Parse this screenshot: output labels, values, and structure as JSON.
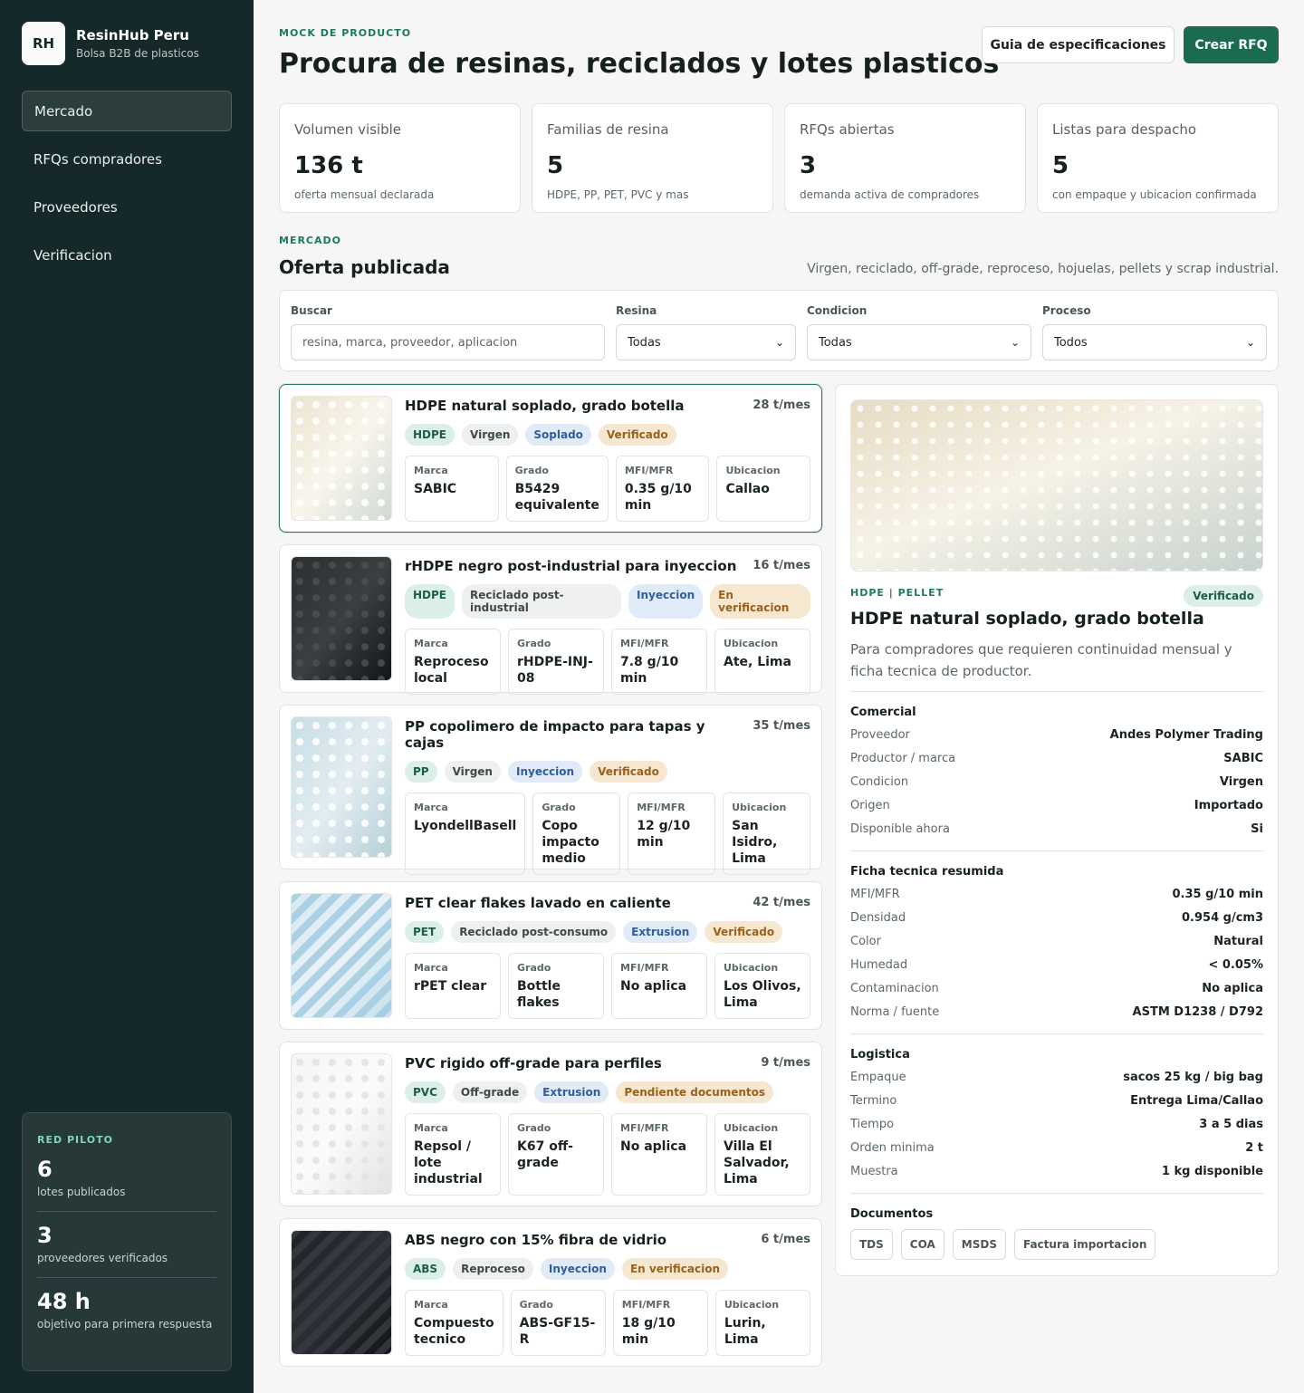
{
  "sidebar": {
    "logo": "RH",
    "brand": "ResinHub Peru",
    "subtitle": "Bolsa B2B de plasticos",
    "nav": [
      "Mercado",
      "RFQs compradores",
      "Proveedores",
      "Verificacion"
    ],
    "active_nav": "Mercado",
    "pilot": {
      "kicker": "RED PILOTO",
      "stats": [
        {
          "value": "6",
          "label": "lotes publicados"
        },
        {
          "value": "3",
          "label": "proveedores verificados"
        },
        {
          "value": "48 h",
          "label": "objetivo para primera respuesta"
        }
      ]
    }
  },
  "header": {
    "kicker": "MOCK DE PRODUCTO",
    "title": "Procura de resinas, reciclados y lotes plasticos",
    "spec_guide_button": "Guia de especificaciones",
    "create_rfq_button": "Crear RFQ"
  },
  "stats": [
    {
      "label": "Volumen visible",
      "value": "136 t",
      "sub": "oferta mensual declarada"
    },
    {
      "label": "Familias de resina",
      "value": "5",
      "sub": "HDPE, PP, PET, PVC y mas"
    },
    {
      "label": "RFQs abiertas",
      "value": "3",
      "sub": "demanda activa de compradores"
    },
    {
      "label": "Listas para despacho",
      "value": "5",
      "sub": "con empaque y ubicacion confirmada"
    }
  ],
  "market": {
    "kicker": "MERCADO",
    "title": "Oferta publicada",
    "description": "Virgen, reciclado, off-grade, reproceso, hojuelas, pellets y scrap industrial."
  },
  "filters": {
    "search_label": "Buscar",
    "search_placeholder": "resina, marca, proveedor, aplicacion",
    "resin_label": "Resina",
    "resin_value": "Todas",
    "condition_label": "Condicion",
    "condition_value": "Todas",
    "process_label": "Proceso",
    "process_value": "Todos"
  },
  "spec_labels": {
    "brand": "Marca",
    "grade": "Grado",
    "mfi": "MFI/MFR",
    "location": "Ubicacion"
  },
  "listings": [
    {
      "title": "HDPE natural soplado, grado botella",
      "volume": "28 t/mes",
      "resin": "HDPE",
      "condition": "Virgen",
      "process": "Soplado",
      "status": "Verificado",
      "brand": "SABIC",
      "grade": "B5429 equivalente",
      "mfi": "0.35 g/10 min",
      "location": "Callao",
      "thumb": "cream-dots",
      "selected": true
    },
    {
      "title": "rHDPE negro post-industrial para inyeccion",
      "volume": "16 t/mes",
      "resin": "HDPE",
      "condition": "Reciclado post-industrial",
      "process": "Inyeccion",
      "status": "En verificacion",
      "brand": "Reproceso local",
      "grade": "rHDPE-INJ-08",
      "mfi": "7.8 g/10 min",
      "location": "Ate, Lima",
      "thumb": "black-dots"
    },
    {
      "title": "PP copolimero de impacto para tapas y cajas",
      "volume": "35 t/mes",
      "resin": "PP",
      "condition": "Virgen",
      "process": "Inyeccion",
      "status": "Verificado",
      "brand": "LyondellBasell",
      "grade": "Copo impacto medio",
      "mfi": "12 g/10 min",
      "location": "San Isidro, Lima",
      "thumb": "blue-dots"
    },
    {
      "title": "PET clear flakes lavado en caliente",
      "volume": "42 t/mes",
      "resin": "PET",
      "condition": "Reciclado post-consumo",
      "process": "Extrusion",
      "status": "Verificado",
      "brand": "rPET clear",
      "grade": "Bottle flakes",
      "mfi": "No aplica",
      "location": "Los Olivos, Lima",
      "thumb": "blue-stripes"
    },
    {
      "title": "PVC rigido off-grade para perfiles",
      "volume": "9 t/mes",
      "resin": "PVC",
      "condition": "Off-grade",
      "process": "Extrusion",
      "status": "Pendiente documentos",
      "brand": "Repsol / lote industrial",
      "grade": "K67 off-grade",
      "mfi": "No aplica",
      "location": "Villa El Salvador, Lima",
      "thumb": "white-dots"
    },
    {
      "title": "ABS negro con 15% fibra de vidrio",
      "volume": "6 t/mes",
      "resin": "ABS",
      "condition": "Reproceso",
      "process": "Inyeccion",
      "status": "En verificacion",
      "brand": "Compuesto tecnico",
      "grade": "ABS-GF15-R",
      "mfi": "18 g/10 min",
      "location": "Lurin, Lima",
      "thumb": "black-stripes"
    }
  ],
  "detail": {
    "kicker": "HDPE | PELLET",
    "badge": "Verificado",
    "title": "HDPE natural soplado, grado botella",
    "description": "Para compradores que requieren continuidad mensual y ficha tecnica de productor.",
    "sections": [
      {
        "title": "Comercial",
        "rows": [
          {
            "k": "Proveedor",
            "v": "Andes Polymer Trading"
          },
          {
            "k": "Productor / marca",
            "v": "SABIC"
          },
          {
            "k": "Condicion",
            "v": "Virgen"
          },
          {
            "k": "Origen",
            "v": "Importado"
          },
          {
            "k": "Disponible ahora",
            "v": "Si"
          }
        ]
      },
      {
        "title": "Ficha tecnica resumida",
        "rows": [
          {
            "k": "MFI/MFR",
            "v": "0.35 g/10 min"
          },
          {
            "k": "Densidad",
            "v": "0.954 g/cm3"
          },
          {
            "k": "Color",
            "v": "Natural"
          },
          {
            "k": "Humedad",
            "v": "< 0.05%"
          },
          {
            "k": "Contaminacion",
            "v": "No aplica"
          },
          {
            "k": "Norma / fuente",
            "v": "ASTM D1238 / D792"
          }
        ]
      },
      {
        "title": "Logistica",
        "rows": [
          {
            "k": "Empaque",
            "v": "sacos 25 kg / big bag"
          },
          {
            "k": "Termino",
            "v": "Entrega Lima/Callao"
          },
          {
            "k": "Tiempo",
            "v": "3 a 5 dias"
          },
          {
            "k": "Orden minima",
            "v": "2 t"
          },
          {
            "k": "Muestra",
            "v": "1 kg disponible"
          }
        ]
      }
    ],
    "documents_title": "Documentos",
    "documents": [
      "TDS",
      "COA",
      "MSDS",
      "Factura importacion"
    ]
  }
}
